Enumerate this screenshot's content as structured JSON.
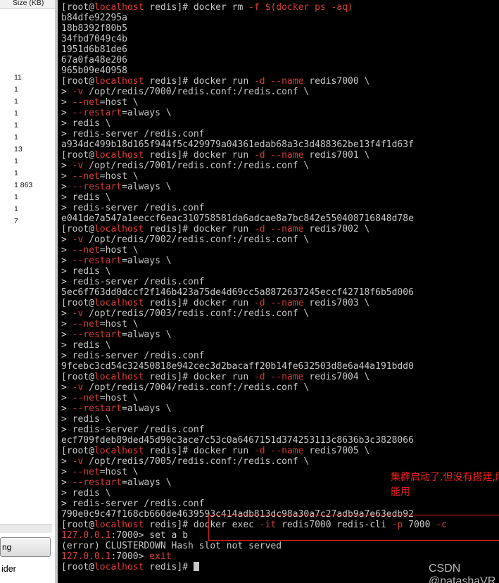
{
  "file_panel": {
    "column_header": "Size (KB)",
    "sizes": [
      "11",
      "1",
      "1",
      "1",
      "1",
      "1",
      "13",
      "1",
      "1",
      "1 863",
      "1",
      "1",
      "7"
    ],
    "button_label": "ng",
    "bottom_label": "ider"
  },
  "terminal": {
    "prompt": {
      "user": "[root@",
      "host": "localhost",
      "rest": " redis]# "
    },
    "cont": "> ",
    "lines": [
      {
        "type": "cmd",
        "parts": [
          {
            "t": "docker rm "
          },
          {
            "t": "-f",
            "c": "opt"
          },
          {
            "t": " "
          },
          {
            "t": "$(docker ps -aq)",
            "c": "opt"
          }
        ]
      },
      {
        "type": "out",
        "text": "b84dfe92295a"
      },
      {
        "type": "out",
        "text": "18b8392f80b5"
      },
      {
        "type": "out",
        "text": "34fbd7049c4b"
      },
      {
        "type": "out",
        "text": "1951d6b81de6"
      },
      {
        "type": "out",
        "text": "67a0fa48e206"
      },
      {
        "type": "out",
        "text": "965b09e40958"
      },
      {
        "type": "cmd",
        "parts": [
          {
            "t": "docker run "
          },
          {
            "t": "-d",
            "c": "opt"
          },
          {
            "t": " "
          },
          {
            "t": "--name",
            "c": "opt"
          },
          {
            "t": " redis7000 \\"
          }
        ]
      },
      {
        "type": "cont",
        "parts": [
          {
            "t": "-v",
            "c": "opt"
          },
          {
            "t": " /opt/redis/7000/redis.conf:/redis.conf \\"
          }
        ]
      },
      {
        "type": "cont",
        "parts": [
          {
            "t": "--net",
            "c": "opt"
          },
          {
            "t": "=host \\"
          }
        ]
      },
      {
        "type": "cont",
        "parts": [
          {
            "t": "--restart",
            "c": "opt"
          },
          {
            "t": "=always \\"
          }
        ]
      },
      {
        "type": "cont",
        "parts": [
          {
            "t": "redis \\"
          }
        ]
      },
      {
        "type": "cont",
        "parts": [
          {
            "t": "redis-server /redis.conf"
          }
        ]
      },
      {
        "type": "out",
        "text": "a934dc499b18d165f944f5c429979a04361edab68a3c3d488362be13f4f1d63f"
      },
      {
        "type": "cmd",
        "parts": [
          {
            "t": "docker run "
          },
          {
            "t": "-d",
            "c": "opt"
          },
          {
            "t": " "
          },
          {
            "t": "--name",
            "c": "opt"
          },
          {
            "t": " redis7001 \\"
          }
        ]
      },
      {
        "type": "cont",
        "parts": [
          {
            "t": "-v",
            "c": "opt"
          },
          {
            "t": " /opt/redis/7001/redis.conf:/redis.conf \\"
          }
        ]
      },
      {
        "type": "cont",
        "parts": [
          {
            "t": "--net",
            "c": "opt"
          },
          {
            "t": "=host \\"
          }
        ]
      },
      {
        "type": "cont",
        "parts": [
          {
            "t": "--restart",
            "c": "opt"
          },
          {
            "t": "=always \\"
          }
        ]
      },
      {
        "type": "cont",
        "parts": [
          {
            "t": "redis \\"
          }
        ]
      },
      {
        "type": "cont",
        "parts": [
          {
            "t": "redis-server /redis.conf"
          }
        ]
      },
      {
        "type": "out",
        "text": "e041de7a547a1eeccf6eac310758581da6adcae8a7bc842e550408716848d78e"
      },
      {
        "type": "cmd",
        "parts": [
          {
            "t": "docker run "
          },
          {
            "t": "-d",
            "c": "opt"
          },
          {
            "t": " "
          },
          {
            "t": "--name",
            "c": "opt"
          },
          {
            "t": " redis7002 \\"
          }
        ]
      },
      {
        "type": "cont",
        "parts": [
          {
            "t": "-v",
            "c": "opt"
          },
          {
            "t": " /opt/redis/7002/redis.conf:/redis.conf \\"
          }
        ]
      },
      {
        "type": "cont",
        "parts": [
          {
            "t": "--net",
            "c": "opt"
          },
          {
            "t": "=host \\"
          }
        ]
      },
      {
        "type": "cont",
        "parts": [
          {
            "t": "--restart",
            "c": "opt"
          },
          {
            "t": "=always \\"
          }
        ]
      },
      {
        "type": "cont",
        "parts": [
          {
            "t": "redis \\"
          }
        ]
      },
      {
        "type": "cont",
        "parts": [
          {
            "t": "redis-server /redis.conf"
          }
        ]
      },
      {
        "type": "out",
        "text": "5ec6f763dd0dccf2f146b423a75de4d69cc5a8872637245eccf42718f6b5d006"
      },
      {
        "type": "cmd",
        "parts": [
          {
            "t": "docker run "
          },
          {
            "t": "-d",
            "c": "opt"
          },
          {
            "t": " "
          },
          {
            "t": "--name",
            "c": "opt"
          },
          {
            "t": " redis7003 \\"
          }
        ]
      },
      {
        "type": "cont",
        "parts": [
          {
            "t": "-v",
            "c": "opt"
          },
          {
            "t": " /opt/redis/7003/redis.conf:/redis.conf \\"
          }
        ]
      },
      {
        "type": "cont",
        "parts": [
          {
            "t": "--net",
            "c": "opt"
          },
          {
            "t": "=host \\"
          }
        ]
      },
      {
        "type": "cont",
        "parts": [
          {
            "t": "--restart",
            "c": "opt"
          },
          {
            "t": "=always \\"
          }
        ]
      },
      {
        "type": "cont",
        "parts": [
          {
            "t": "redis \\"
          }
        ]
      },
      {
        "type": "cont",
        "parts": [
          {
            "t": "redis-server /redis.conf"
          }
        ]
      },
      {
        "type": "out",
        "text": "9fcebc3cd54c32450818e942cec3d2bacaff20b14fe632503d8e6a44a191bdd0"
      },
      {
        "type": "cmd",
        "parts": [
          {
            "t": "docker run "
          },
          {
            "t": "-d",
            "c": "opt"
          },
          {
            "t": " "
          },
          {
            "t": "--name",
            "c": "opt"
          },
          {
            "t": " redis7004 \\"
          }
        ]
      },
      {
        "type": "cont",
        "parts": [
          {
            "t": "-v",
            "c": "opt"
          },
          {
            "t": " /opt/redis/7004/redis.conf:/redis.conf \\"
          }
        ]
      },
      {
        "type": "cont",
        "parts": [
          {
            "t": "--net",
            "c": "opt"
          },
          {
            "t": "=host \\"
          }
        ]
      },
      {
        "type": "cont",
        "parts": [
          {
            "t": "--restart",
            "c": "opt"
          },
          {
            "t": "=always \\"
          }
        ]
      },
      {
        "type": "cont",
        "parts": [
          {
            "t": "redis \\"
          }
        ]
      },
      {
        "type": "cont",
        "parts": [
          {
            "t": "redis-server /redis.conf"
          }
        ]
      },
      {
        "type": "out",
        "text": "ecf709fdeb89ded45d90c3ace7c53c0a6467151d374253113c8636b3c3828066"
      },
      {
        "type": "cmd",
        "parts": [
          {
            "t": "docker run "
          },
          {
            "t": "-d",
            "c": "opt"
          },
          {
            "t": " "
          },
          {
            "t": "--name",
            "c": "opt"
          },
          {
            "t": " redis7005 \\"
          }
        ]
      },
      {
        "type": "cont",
        "parts": [
          {
            "t": "-v",
            "c": "opt"
          },
          {
            "t": " /opt/redis/7005/redis.conf:/redis.conf \\"
          }
        ]
      },
      {
        "type": "cont",
        "parts": [
          {
            "t": "--net",
            "c": "opt"
          },
          {
            "t": "=host \\"
          }
        ]
      },
      {
        "type": "cont",
        "parts": [
          {
            "t": "--restart",
            "c": "opt"
          },
          {
            "t": "=always \\"
          }
        ]
      },
      {
        "type": "cont",
        "parts": [
          {
            "t": "redis \\"
          }
        ]
      },
      {
        "type": "cont",
        "parts": [
          {
            "t": "redis-server /redis.conf"
          }
        ]
      },
      {
        "type": "out",
        "text": "790e0c9c47f168cb660de4639593c414adb813dc98a30a7c27adb9a7e63edb92"
      },
      {
        "type": "cmd",
        "parts": [
          {
            "t": "docker exec "
          },
          {
            "t": "-it",
            "c": "opt"
          },
          {
            "t": " redis7000 redis-cli "
          },
          {
            "t": "-p",
            "c": "opt"
          },
          {
            "t": " 7000 "
          },
          {
            "t": "-c",
            "c": "opt"
          }
        ]
      },
      {
        "type": "redis",
        "ip": "127.0.0.1",
        "port": ":7000> ",
        "parts": [
          {
            "t": "set a b"
          }
        ]
      },
      {
        "type": "out",
        "text": "(error) CLUSTERDOWN Hash slot not served"
      },
      {
        "type": "redis",
        "ip": "127.0.0.1",
        "port": ":7000> ",
        "parts": [
          {
            "t": "exit",
            "c": "exitcmd"
          }
        ]
      },
      {
        "type": "cmd",
        "parts": [],
        "cursor": true
      }
    ]
  },
  "annotation": "集群启动了,但没有搭建,所以还是不能用",
  "watermark": "CSDN @natashaVR",
  "colors": {
    "terminal_bg": "#000000",
    "text": "#c7c7c7",
    "highlight": "#e33939",
    "annotation": "#e82020"
  }
}
